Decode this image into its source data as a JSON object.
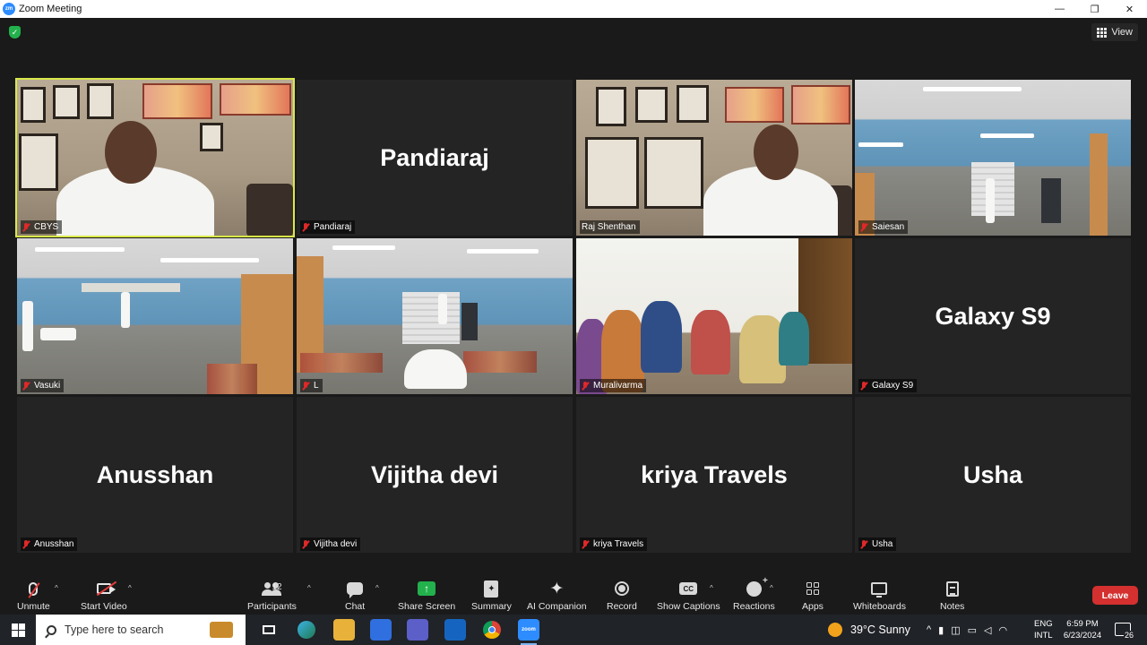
{
  "window": {
    "title": "Zoom Meeting",
    "controls": {
      "minimize": "—",
      "restore": "❐",
      "close": "✕"
    }
  },
  "top": {
    "view_label": "View",
    "security_icon": "shield-check-icon"
  },
  "participants": [
    {
      "name": "CBYS",
      "video": true,
      "active": true
    },
    {
      "name": "Pandiaraj",
      "video": false
    },
    {
      "name": "Raj Shenthan",
      "video": true
    },
    {
      "name": "Saiesan",
      "video": true
    },
    {
      "name": "Vasuki",
      "video": true
    },
    {
      "name": "L",
      "video": true
    },
    {
      "name": "Muralivarma",
      "video": true
    },
    {
      "name": "Galaxy S9",
      "video": false
    },
    {
      "name": "Anusshan",
      "video": false
    },
    {
      "name": "Vijitha devi",
      "video": false
    },
    {
      "name": "kriya Travels",
      "video": false
    },
    {
      "name": "Usha",
      "video": false
    }
  ],
  "toolbar": {
    "unmute": "Unmute",
    "start_video": "Start Video",
    "participants": "Participants",
    "participants_count": "12",
    "chat": "Chat",
    "share_screen": "Share Screen",
    "summary": "Summary",
    "ai_companion": "AI Companion",
    "record": "Record",
    "show_captions": "Show Captions",
    "cc": "CC",
    "reactions": "Reactions",
    "apps": "Apps",
    "whiteboards": "Whiteboards",
    "notes": "Notes",
    "leave": "Leave",
    "caret": "^"
  },
  "taskbar": {
    "search_placeholder": "Type here to search",
    "weather": "39°C  Sunny",
    "lang_top": "ENG",
    "lang_bottom": "INTL",
    "time": "6:59 PM",
    "date": "6/23/2024",
    "notifications": "26",
    "zoom_app": "zoom"
  },
  "colors": {
    "active_border": "#d9e84a",
    "leave": "#d3302f",
    "share": "#22b14c",
    "muted": "#e02828"
  }
}
